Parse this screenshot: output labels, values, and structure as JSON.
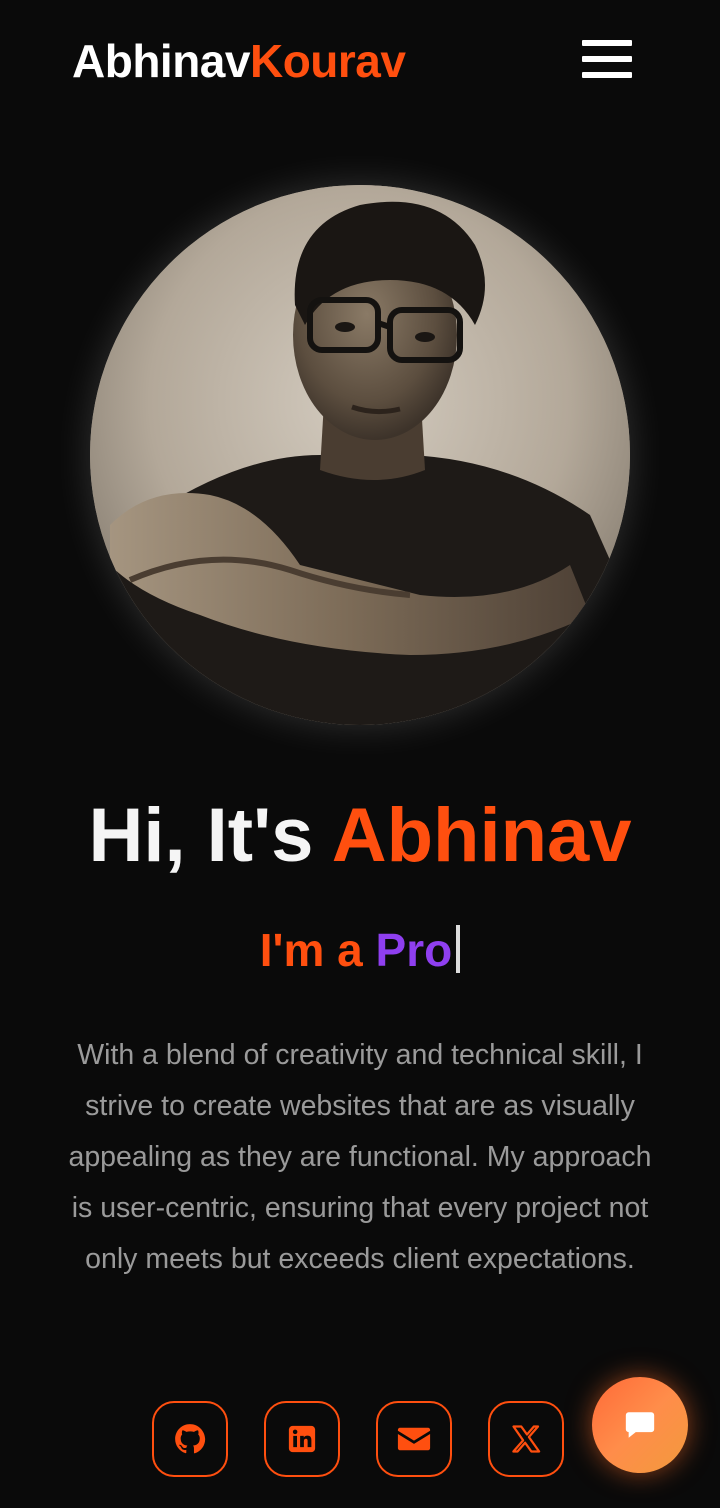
{
  "header": {
    "logo_first": "Abhinav",
    "logo_last": "Kourav",
    "menu_icon": "hamburger-menu-icon"
  },
  "hero": {
    "greeting_prefix": "Hi, It's",
    "greeting_name": "Abhinav",
    "role_prefix": "I'm a",
    "role_word": "Pro",
    "bio": "With a blend of creativity and technical skill, I strive to create websites that are as visually appealing as they are functional. My approach is user-centric, ensuring that every project not only meets but exceeds client expectations."
  },
  "social": {
    "links": [
      {
        "icon": "github-icon"
      },
      {
        "icon": "linkedin-icon"
      },
      {
        "icon": "email-icon"
      },
      {
        "icon": "x-twitter-icon"
      }
    ]
  },
  "chat": {
    "icon": "chat-bubble-icon"
  },
  "colors": {
    "background": "#0a0a0a",
    "accent": "#ff4f0f",
    "purple": "#8f3ff0",
    "text": "#f5f5f5",
    "muted": "#9a9a9a"
  }
}
